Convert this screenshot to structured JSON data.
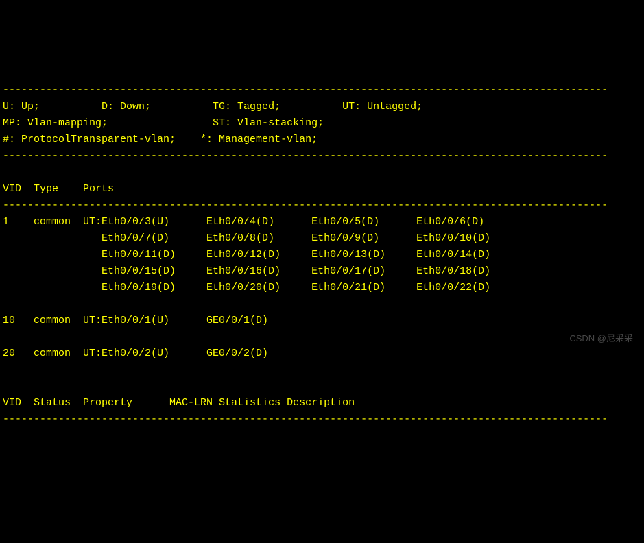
{
  "divider": "--------------------------------------------------------------------------------------------------",
  "legend": {
    "line1": "U: Up;          D: Down;          TG: Tagged;          UT: Untagged;",
    "line2": "MP: Vlan-mapping;                 ST: Vlan-stacking;",
    "line3": "#: ProtocolTransparent-vlan;    *: Management-vlan;"
  },
  "header1": "VID  Type    Ports",
  "vlans": [
    {
      "vid": "1",
      "type": "common",
      "line1": "1    common  UT:Eth0/0/3(U)      Eth0/0/4(D)      Eth0/0/5(D)      Eth0/0/6(D)",
      "line2": "                Eth0/0/7(D)      Eth0/0/8(D)      Eth0/0/9(D)      Eth0/0/10(D)",
      "line3": "                Eth0/0/11(D)     Eth0/0/12(D)     Eth0/0/13(D)     Eth0/0/14(D)",
      "line4": "                Eth0/0/15(D)     Eth0/0/16(D)     Eth0/0/17(D)     Eth0/0/18(D)",
      "line5": "                Eth0/0/19(D)     Eth0/0/20(D)     Eth0/0/21(D)     Eth0/0/22(D)"
    },
    {
      "vid": "10",
      "type": "common",
      "line1": "10   common  UT:Eth0/0/1(U)      GE0/0/1(D)"
    },
    {
      "vid": "20",
      "type": "common",
      "line1": "20   common  UT:Eth0/0/2(U)      GE0/0/2(D)"
    }
  ],
  "header2": "VID  Status  Property      MAC-LRN Statistics Description",
  "watermark": "CSDN @尼采采"
}
